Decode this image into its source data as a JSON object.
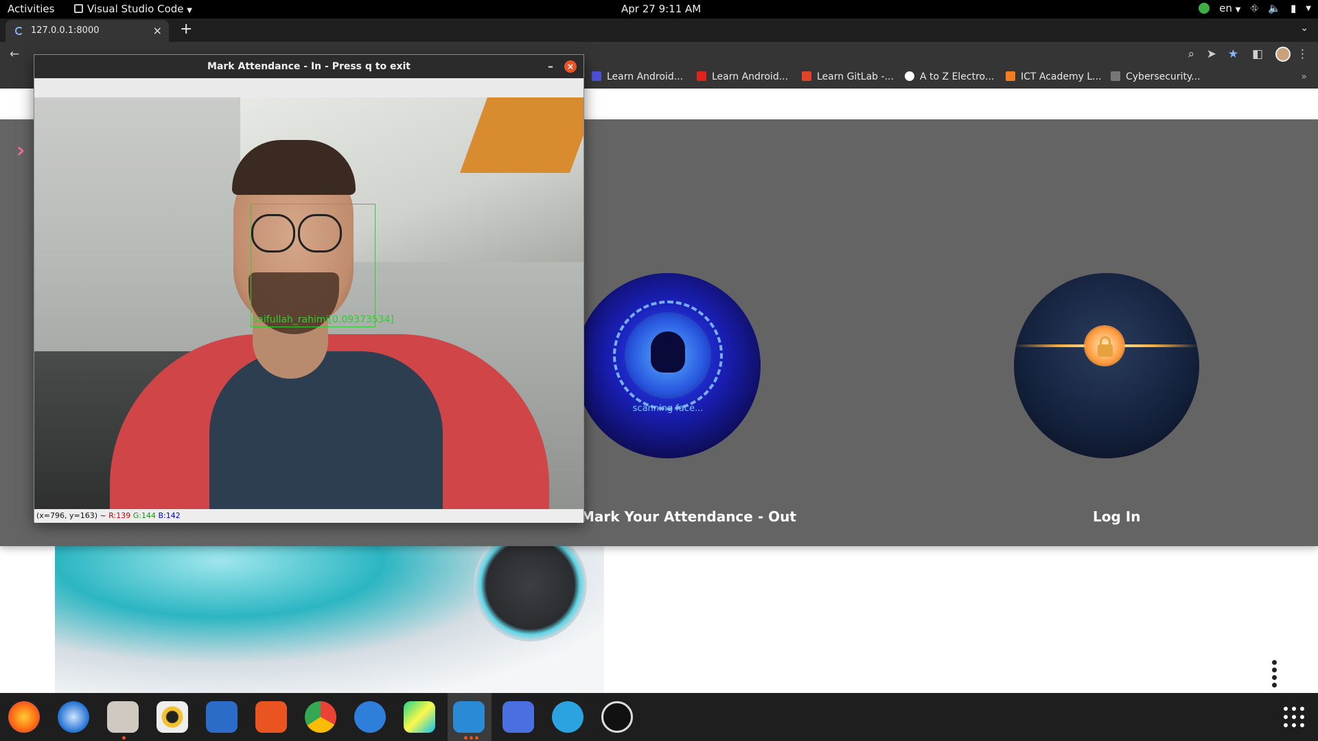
{
  "topbar": {
    "activities": "Activities",
    "app_name": "Visual Studio Code",
    "clock": "Apr 27  9:11 AM",
    "lang": "en"
  },
  "browser": {
    "tab_title": "127.0.0.1:8000",
    "bookmarks": [
      {
        "label": "Learn Android...",
        "color": "#4b52d6"
      },
      {
        "label": "Learn Android...",
        "color": "#e0241c"
      },
      {
        "label": "Learn GitLab -...",
        "color": "#e2432a"
      },
      {
        "label": "A to Z Electro...",
        "color": "#ffffff"
      },
      {
        "label": "ICT Academy L...",
        "color": "#f57c1f"
      },
      {
        "label": "Cybersecurity...",
        "color": "#777777"
      }
    ]
  },
  "page": {
    "card_out_label": "Mark Your Attendance - Out",
    "card_login_label": "Log In",
    "scan_caption": "scanning face...",
    "accent_color": "#646464"
  },
  "cv_window": {
    "title": "Mark Attendance - In - Press q to exit",
    "face_label": "saifullah_rahimi[0.09373534]",
    "status_coords": "(x=796, y=163) ~",
    "status_r": "R:139",
    "status_g": "G:144",
    "status_b": "B:142"
  },
  "dock": {
    "apps": [
      "firefox-icon",
      "thunderbird-icon",
      "files-icon",
      "rhythmbox-icon",
      "writer-icon",
      "software-icon",
      "chrome-icon",
      "help-icon",
      "pycharm-icon",
      "vscode-icon",
      "screenshot-icon",
      "telegram-icon",
      "obs-icon"
    ]
  }
}
